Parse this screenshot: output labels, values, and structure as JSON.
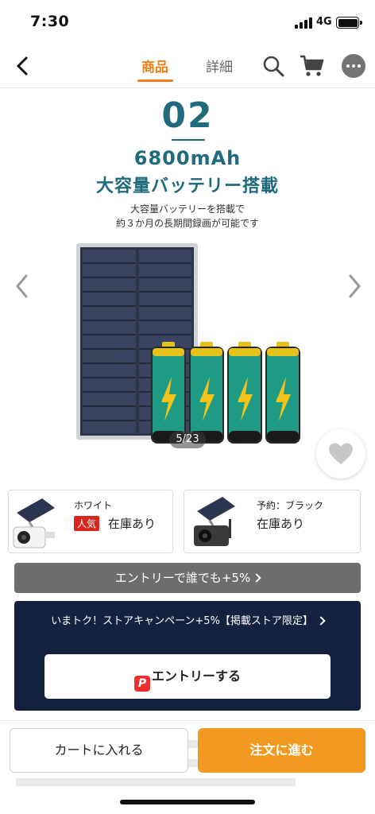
{
  "status_bar": {
    "time": "7:30",
    "network": "4G"
  },
  "nav": {
    "tab_product": "商品",
    "tab_detail": "詳細"
  },
  "hero": {
    "number": "02",
    "spec": "6800mAh",
    "headline": "大容量バッテリー搭載",
    "desc_line1": "大容量バッテリーを搭載で",
    "desc_line2": "約３か月の長期間録画が可能です",
    "counter": "5/23"
  },
  "variants": [
    {
      "label": "ホワイト",
      "badge": "人気",
      "stock": "在庫あり"
    },
    {
      "label": "予約：ブラック",
      "stock": "在庫あり"
    }
  ],
  "entry_bar": {
    "label": "エントリーで誰でも+5%"
  },
  "campaign": {
    "text": "いまトク！ストアキャンペーン+5%【掲載ストア限定】",
    "button_icon": "P",
    "button_label": "エントリーする"
  },
  "bottom_bar": {
    "cart_label": "カートに入れる",
    "order_label": "注文に進む"
  },
  "colors": {
    "accent": "#ef7f1a",
    "teal": "#1f6a7d",
    "navy": "#14223f",
    "order": "#f29a1f",
    "badge": "#d8261d"
  },
  "icons": [
    "back-arrow-icon",
    "search-icon",
    "cart-icon",
    "more-icon",
    "chevron-left-icon",
    "chevron-right-icon",
    "heart-icon",
    "paypay-icon"
  ]
}
